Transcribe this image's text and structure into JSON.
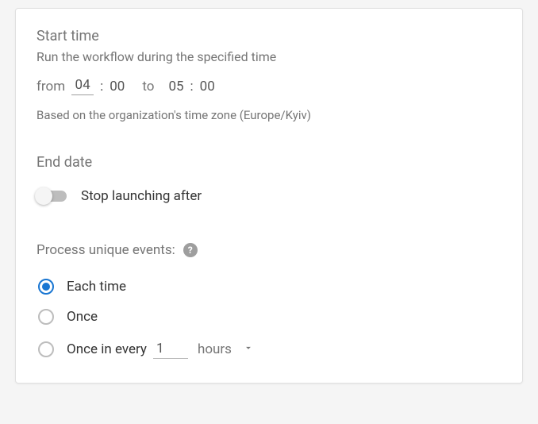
{
  "start_time": {
    "title": "Start time",
    "desc": "Run the workflow during the specified time",
    "from_label": "from",
    "from_hour": "04",
    "from_min": "00",
    "to_label": "to",
    "to_hour": "05",
    "to_min": "00",
    "colon": ":",
    "tz_note": "Based on the organization's time zone (Europe/Kyiv)"
  },
  "end_date": {
    "title": "End date",
    "toggle_label": "Stop launching after"
  },
  "process_events": {
    "title": "Process unique events:",
    "help_glyph": "?",
    "options": {
      "each_time": "Each time",
      "once": "Once",
      "once_every_prefix": "Once in every",
      "interval_value": "1",
      "interval_unit": "hours"
    }
  }
}
